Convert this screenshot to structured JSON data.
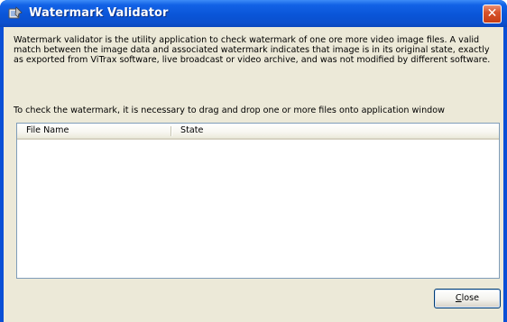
{
  "window": {
    "title": "Watermark Validator",
    "close_glyph": "✕",
    "icon": "watermark-app-icon"
  },
  "description": "Watermark validator is the utility application to check watermark of one ore more video image files. A valid match between the image data and associated watermark indicates that image is in its original state, exactly as exported from ViTrax software, live broadcast or video archive, and was not modified by different software.",
  "instruction": "To check the watermark, it is necessary to drag and drop one or more files onto application window",
  "file_list": {
    "columns": [
      "File Name",
      "State"
    ],
    "rows": []
  },
  "buttons": {
    "close_mnemonic": "C",
    "close_rest": "lose"
  },
  "colors": {
    "titlebar": "#0a55d8",
    "client_bg": "#ece9d8",
    "close_red": "#d8532c"
  }
}
